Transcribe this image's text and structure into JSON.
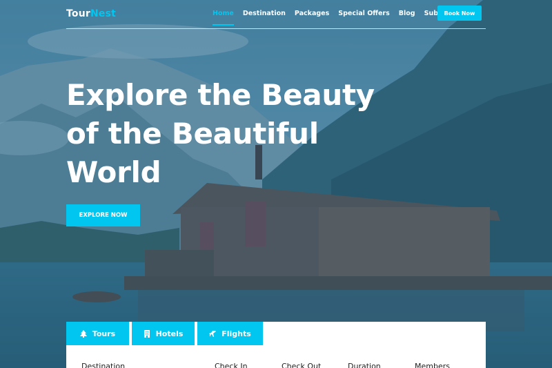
{
  "brand": {
    "logo_part1": "Tour",
    "logo_part2": "Nest"
  },
  "nav": {
    "items": [
      {
        "label": "Home",
        "active": true
      },
      {
        "label": "Destination",
        "active": false
      },
      {
        "label": "Packages",
        "active": false
      },
      {
        "label": "Special Offers",
        "active": false
      },
      {
        "label": "Blog",
        "active": false
      },
      {
        "label": "Subscription",
        "active": false
      }
    ],
    "book_label": "Book Now"
  },
  "hero": {
    "line1": "Explore the Beauty",
    "line2": "of the Beautiful",
    "line3": "World",
    "cta_label": "EXPLORE NOW"
  },
  "booking": {
    "tabs": [
      {
        "label": "Tours",
        "icon": "tree-icon"
      },
      {
        "label": "Hotels",
        "icon": "building-icon"
      },
      {
        "label": "Flights",
        "icon": "plane-icon"
      }
    ],
    "fields": [
      "Destination",
      "Check In",
      "Check Out",
      "Duration",
      "Members"
    ]
  },
  "colors": {
    "accent": "#00c6f0",
    "overlay": "#2d6a8c",
    "text_dark": "#1e1e1e"
  }
}
